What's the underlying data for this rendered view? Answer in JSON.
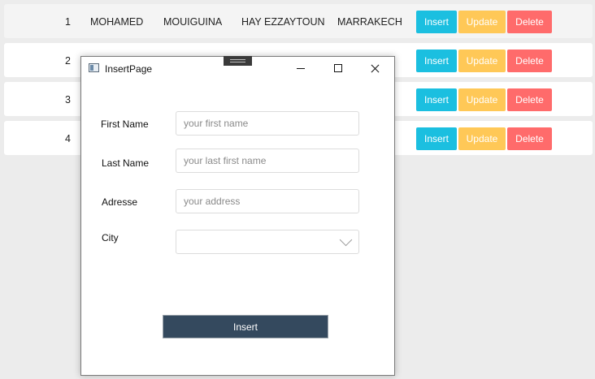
{
  "table": {
    "rows": [
      {
        "id": "1",
        "first_name": "MOHAMED",
        "last_name": "MOUIGUINA",
        "address": "HAY EZZAYTOUN",
        "city": "MARRAKECH"
      },
      {
        "id": "2"
      },
      {
        "id": "3"
      },
      {
        "id": "4"
      }
    ],
    "actions": {
      "insert": "Insert",
      "update": "Update",
      "delete": "Delete"
    }
  },
  "dialog": {
    "title": "InsertPage",
    "fields": {
      "first_name": {
        "label": "First Name",
        "placeholder": "your first name",
        "value": ""
      },
      "last_name": {
        "label": "Last Name",
        "placeholder": "your last first name",
        "value": ""
      },
      "address": {
        "label": "Adresse",
        "placeholder": "your address",
        "value": ""
      },
      "city": {
        "label": "City",
        "value": ""
      }
    },
    "submit_label": "Insert"
  },
  "colors": {
    "insert": "#1bbfe0",
    "update": "#ffc857",
    "delete": "#ff6b6b",
    "submit": "#34495e"
  }
}
